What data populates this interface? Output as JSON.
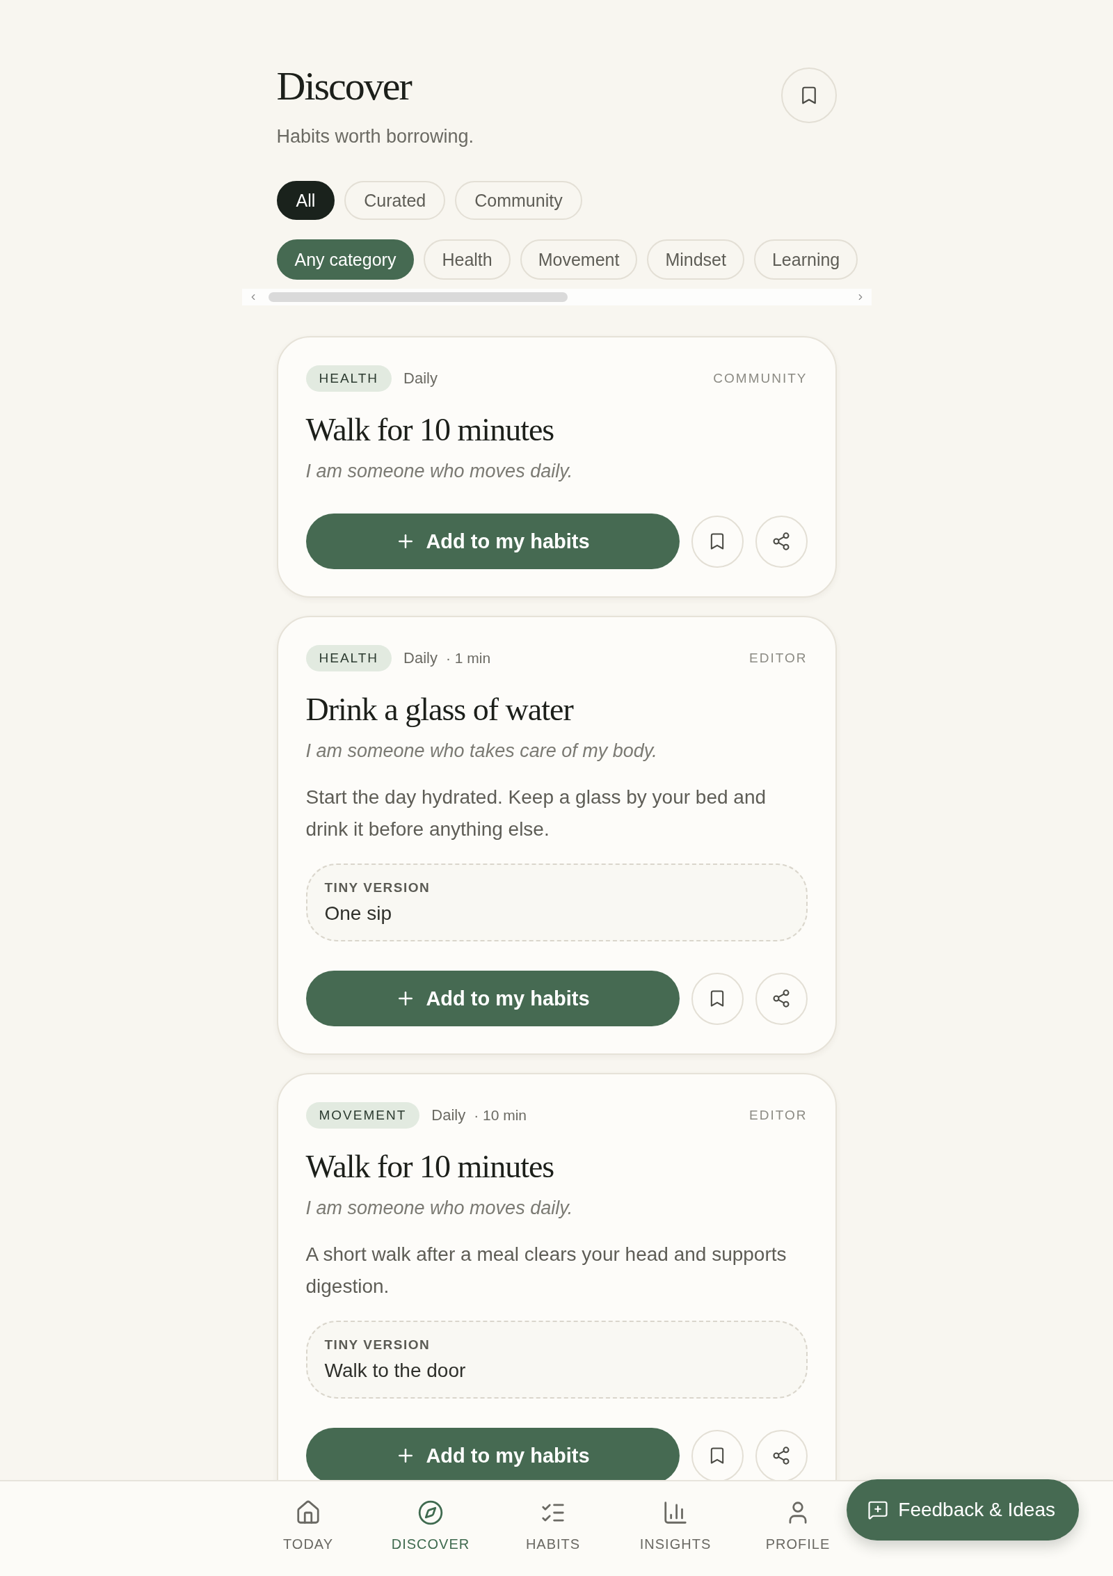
{
  "header": {
    "title": "Discover",
    "subtitle": "Habits worth borrowing."
  },
  "source_tabs": [
    {
      "label": "All",
      "selected": true
    },
    {
      "label": "Curated",
      "selected": false
    },
    {
      "label": "Community",
      "selected": false
    }
  ],
  "category_chips": [
    {
      "label": "Any category",
      "selected": true
    },
    {
      "label": "Health",
      "selected": false
    },
    {
      "label": "Movement",
      "selected": false
    },
    {
      "label": "Mindset",
      "selected": false
    },
    {
      "label": "Learning",
      "selected": false
    }
  ],
  "habit_cards": [
    {
      "category": "HEALTH",
      "frequency": "Daily",
      "source": "COMMUNITY",
      "title": "Walk for 10 minutes",
      "identity": "I am someone who moves daily.",
      "add_button": "Add to my habits"
    },
    {
      "category": "HEALTH",
      "frequency": "Daily",
      "duration": "· 1 min",
      "source": "EDITOR",
      "title": "Drink a glass of water",
      "identity": "I am someone who takes care of my body.",
      "description": "Start the day hydrated. Keep a glass by your bed and drink it before anything else.",
      "tiny_version": {
        "label": "TINY VERSION",
        "value": "One sip"
      },
      "add_button": "Add to my habits"
    },
    {
      "category": "MOVEMENT",
      "frequency": "Daily",
      "duration": "· 10 min",
      "source": "EDITOR",
      "title": "Walk for 10 minutes",
      "identity": "I am someone who moves daily.",
      "description": "A short walk after a meal clears your head and supports digestion.",
      "tiny_version": {
        "label": "TINY VERSION",
        "value": "Walk to the door"
      },
      "add_button": "Add to my habits"
    }
  ],
  "bottom_nav": [
    {
      "label": "TODAY",
      "selected": false
    },
    {
      "label": "DISCOVER",
      "selected": true
    },
    {
      "label": "HABITS",
      "selected": false
    },
    {
      "label": "INSIGHTS",
      "selected": false
    },
    {
      "label": "PROFILE",
      "selected": false
    }
  ],
  "feedback_button": {
    "label": "Feedback & Ideas"
  }
}
